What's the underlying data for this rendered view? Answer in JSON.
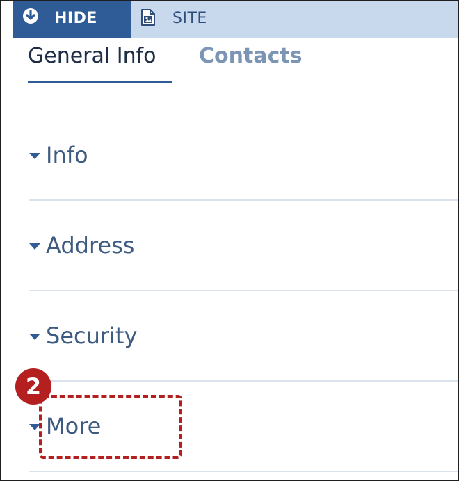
{
  "toolbar": {
    "hide_label": "HIDE",
    "site_label": "SITE",
    "background": "#c8d9ee",
    "hide_background": "#2f5c96"
  },
  "tabs": [
    {
      "label": "General Info",
      "active": true
    },
    {
      "label": "Contacts",
      "active": false
    }
  ],
  "sections": [
    {
      "label": "Info",
      "icon": "caret-down-icon"
    },
    {
      "label": "Address",
      "icon": "caret-down-icon"
    },
    {
      "label": "Security",
      "icon": "caret-down-icon"
    },
    {
      "label": "More",
      "icon": "caret-down-icon"
    }
  ],
  "callout": {
    "number": "2",
    "color": "#b41f1f"
  },
  "colors": {
    "accent": "#2f5c96",
    "section_text": "#3d5a80",
    "inactive_tab": "#7d95b5",
    "divider": "#dbe3ee"
  }
}
